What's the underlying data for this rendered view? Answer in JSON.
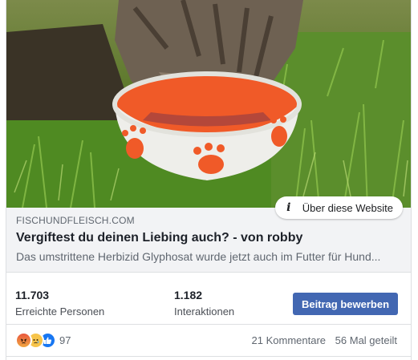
{
  "preview": {
    "about_label": "Über diese Website",
    "domain": "FISCHUNDFLEISCH.COM",
    "title": "Vergiftest du deinen Liebing auch? - von robby",
    "description": "Das umstrittene Herbizid Glyphosat wurde jetzt auch im Futter für Hund..."
  },
  "stats": {
    "reach_value": "11.703",
    "reach_label": "Erreichte Personen",
    "engagement_value": "1.182",
    "engagement_label": "Interaktionen",
    "promote_label": "Beitrag bewerben"
  },
  "reactions": {
    "icons": [
      "angry-reaction-icon",
      "sad-reaction-icon",
      "like-reaction-icon"
    ],
    "count": "97"
  },
  "meta": {
    "comments": "21 Kommentare",
    "shares": "56 Mal geteilt"
  },
  "colors": {
    "accent": "#4267b2",
    "link_bg": "#f2f3f5",
    "bowl_orange": "#f05a28"
  }
}
